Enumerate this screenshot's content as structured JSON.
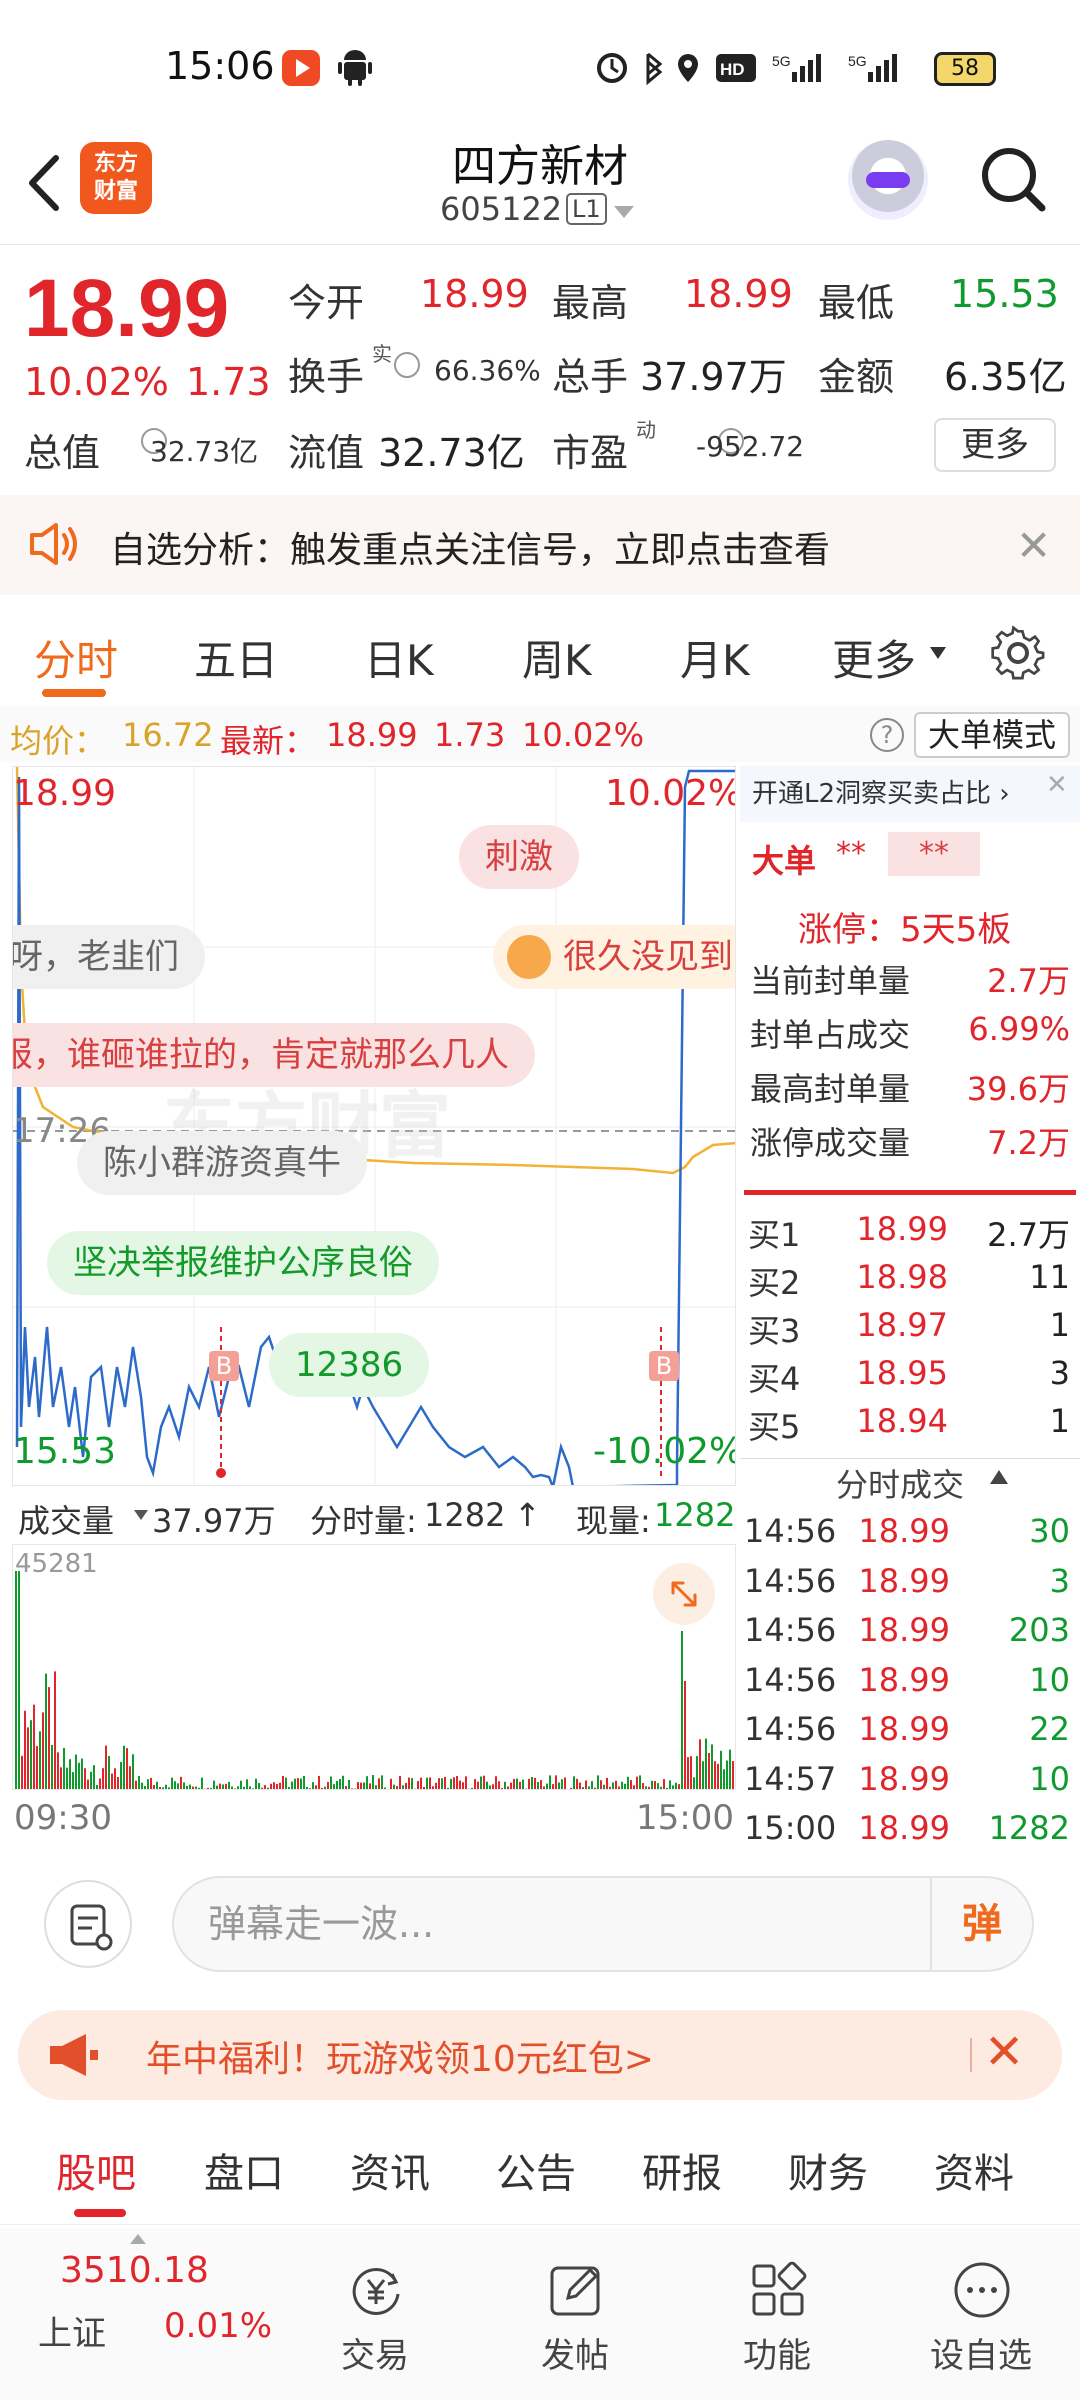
{
  "status_bar": {
    "time": "15:06",
    "network": "5G",
    "battery": "58"
  },
  "header": {
    "logo_text": "东方财富",
    "title": "四方新材",
    "code": "605122",
    "level": "L1"
  },
  "quote": {
    "price": "18.99",
    "change_pct": "10.02%",
    "change": "1.73",
    "open_label": "今开",
    "open": "18.99",
    "high_label": "最高",
    "high": "18.99",
    "low_label": "最低",
    "low": "15.53",
    "turnover_label": "换手",
    "turnover_sup": "实",
    "turnover": "66.36%",
    "volume_label": "总手",
    "volume": "37.97万",
    "amount_label": "金额",
    "amount": "6.35亿",
    "mktcap_label": "总值",
    "mktcap": "32.73亿",
    "float_label": "流值",
    "float": "32.73亿",
    "pe_label": "市盈",
    "pe_sup": "动",
    "pe": "-952.72",
    "more_btn": "更多"
  },
  "alert": {
    "text": "自选分析：触发重点关注信号，立即点击查看"
  },
  "tabs": [
    "分时",
    "五日",
    "日K",
    "周K",
    "月K",
    "更多"
  ],
  "active_tab": "分时",
  "avg_line": {
    "avg_label": "均价：",
    "avg": "16.72",
    "latest_label": "最新：",
    "latest": "18.99",
    "chg": "1.73",
    "pct": "10.02%",
    "big_order_btn": "大单模式",
    "help": "?"
  },
  "chart": {
    "top_price": "18.99",
    "top_pct": "10.02%",
    "bottom_price": "15.53",
    "bottom_pct": "-10.02%",
    "mid_time": "17:26",
    "buy_marker": "B",
    "danmu": [
      "刺激",
      "呀，老韭们",
      "很久没见到",
      "报，谁砸谁拉的，肯定就那么几人",
      "陈小群游资真牛",
      "坚决举报维护公序良俗",
      "12386"
    ],
    "watermark": "东方财富"
  },
  "volume_bar": {
    "label": "成交量",
    "total": "37.97万",
    "tick_label": "分时量:",
    "tick": "1282",
    "now_label": "现量:",
    "now": "1282",
    "max": "45281",
    "time_start": "09:30",
    "time_end": "15:00"
  },
  "right_panel": {
    "header": "开通L2洞察买卖占比",
    "big_order_label": "大单",
    "big_order_val1": "**",
    "big_order_val2": "**",
    "limit_title": "涨停：5天5板",
    "stats": [
      {
        "label": "当前封单量",
        "value": "2.7万"
      },
      {
        "label": "封单占成交",
        "value": "6.99%"
      },
      {
        "label": "最高封单量",
        "value": "39.6万"
      },
      {
        "label": "涨停成交量",
        "value": "7.2万"
      }
    ],
    "bids": [
      {
        "label": "买1",
        "price": "18.99",
        "vol": "2.7万"
      },
      {
        "label": "买2",
        "price": "18.98",
        "vol": "11"
      },
      {
        "label": "买3",
        "price": "18.97",
        "vol": "1"
      },
      {
        "label": "买4",
        "price": "18.95",
        "vol": "3"
      },
      {
        "label": "买5",
        "price": "18.94",
        "vol": "1"
      }
    ],
    "ticks_title": "分时成交",
    "ticks": [
      {
        "time": "14:56",
        "price": "18.99",
        "vol": "30"
      },
      {
        "time": "14:56",
        "price": "18.99",
        "vol": "3"
      },
      {
        "time": "14:56",
        "price": "18.99",
        "vol": "203"
      },
      {
        "time": "14:56",
        "price": "18.99",
        "vol": "10"
      },
      {
        "time": "14:56",
        "price": "18.99",
        "vol": "22"
      },
      {
        "time": "14:57",
        "price": "18.99",
        "vol": "10"
      },
      {
        "time": "15:00",
        "price": "18.99",
        "vol": "1282"
      }
    ]
  },
  "comment_bar": {
    "placeholder": "弹幕走一波...",
    "send": "弹"
  },
  "promo": {
    "text": "年中福利！玩游戏领10元红包>"
  },
  "bottom_tabs": [
    "股吧",
    "盘口",
    "资讯",
    "公告",
    "研报",
    "财务",
    "资料"
  ],
  "nav": {
    "index_value": "3510.18",
    "index_name": "上证",
    "index_pct": "0.01%",
    "items": [
      "交易",
      "发帖",
      "功能",
      "设自选"
    ]
  },
  "colors": {
    "up": "#e0252b",
    "down": "#0f9a2e",
    "accent": "#f06a1e",
    "price_line": "#2d6bc9",
    "avg_line": "#f2b233"
  }
}
